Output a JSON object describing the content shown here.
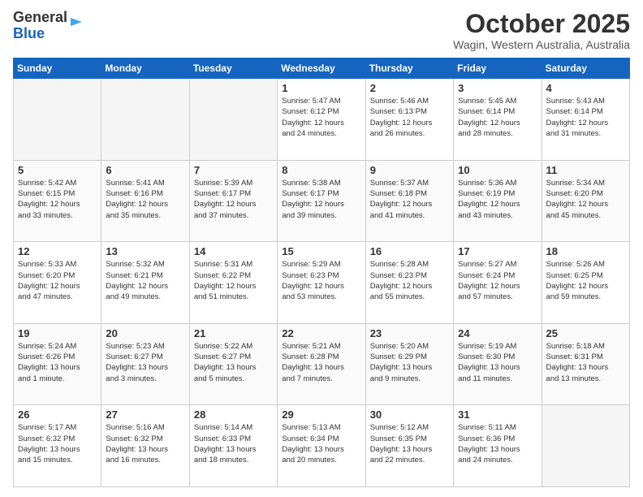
{
  "header": {
    "logo_general": "General",
    "logo_blue": "Blue",
    "month_title": "October 2025",
    "location": "Wagin, Western Australia, Australia"
  },
  "days_of_week": [
    "Sunday",
    "Monday",
    "Tuesday",
    "Wednesday",
    "Thursday",
    "Friday",
    "Saturday"
  ],
  "weeks": [
    [
      {
        "day": "",
        "info": ""
      },
      {
        "day": "",
        "info": ""
      },
      {
        "day": "",
        "info": ""
      },
      {
        "day": "1",
        "info": "Sunrise: 5:47 AM\nSunset: 6:12 PM\nDaylight: 12 hours\nand 24 minutes."
      },
      {
        "day": "2",
        "info": "Sunrise: 5:46 AM\nSunset: 6:13 PM\nDaylight: 12 hours\nand 26 minutes."
      },
      {
        "day": "3",
        "info": "Sunrise: 5:45 AM\nSunset: 6:14 PM\nDaylight: 12 hours\nand 28 minutes."
      },
      {
        "day": "4",
        "info": "Sunrise: 5:43 AM\nSunset: 6:14 PM\nDaylight: 12 hours\nand 31 minutes."
      }
    ],
    [
      {
        "day": "5",
        "info": "Sunrise: 5:42 AM\nSunset: 6:15 PM\nDaylight: 12 hours\nand 33 minutes."
      },
      {
        "day": "6",
        "info": "Sunrise: 5:41 AM\nSunset: 6:16 PM\nDaylight: 12 hours\nand 35 minutes."
      },
      {
        "day": "7",
        "info": "Sunrise: 5:39 AM\nSunset: 6:17 PM\nDaylight: 12 hours\nand 37 minutes."
      },
      {
        "day": "8",
        "info": "Sunrise: 5:38 AM\nSunset: 6:17 PM\nDaylight: 12 hours\nand 39 minutes."
      },
      {
        "day": "9",
        "info": "Sunrise: 5:37 AM\nSunset: 6:18 PM\nDaylight: 12 hours\nand 41 minutes."
      },
      {
        "day": "10",
        "info": "Sunrise: 5:36 AM\nSunset: 6:19 PM\nDaylight: 12 hours\nand 43 minutes."
      },
      {
        "day": "11",
        "info": "Sunrise: 5:34 AM\nSunset: 6:20 PM\nDaylight: 12 hours\nand 45 minutes."
      }
    ],
    [
      {
        "day": "12",
        "info": "Sunrise: 5:33 AM\nSunset: 6:20 PM\nDaylight: 12 hours\nand 47 minutes."
      },
      {
        "day": "13",
        "info": "Sunrise: 5:32 AM\nSunset: 6:21 PM\nDaylight: 12 hours\nand 49 minutes."
      },
      {
        "day": "14",
        "info": "Sunrise: 5:31 AM\nSunset: 6:22 PM\nDaylight: 12 hours\nand 51 minutes."
      },
      {
        "day": "15",
        "info": "Sunrise: 5:29 AM\nSunset: 6:23 PM\nDaylight: 12 hours\nand 53 minutes."
      },
      {
        "day": "16",
        "info": "Sunrise: 5:28 AM\nSunset: 6:23 PM\nDaylight: 12 hours\nand 55 minutes."
      },
      {
        "day": "17",
        "info": "Sunrise: 5:27 AM\nSunset: 6:24 PM\nDaylight: 12 hours\nand 57 minutes."
      },
      {
        "day": "18",
        "info": "Sunrise: 5:26 AM\nSunset: 6:25 PM\nDaylight: 12 hours\nand 59 minutes."
      }
    ],
    [
      {
        "day": "19",
        "info": "Sunrise: 5:24 AM\nSunset: 6:26 PM\nDaylight: 13 hours\nand 1 minute."
      },
      {
        "day": "20",
        "info": "Sunrise: 5:23 AM\nSunset: 6:27 PM\nDaylight: 13 hours\nand 3 minutes."
      },
      {
        "day": "21",
        "info": "Sunrise: 5:22 AM\nSunset: 6:27 PM\nDaylight: 13 hours\nand 5 minutes."
      },
      {
        "day": "22",
        "info": "Sunrise: 5:21 AM\nSunset: 6:28 PM\nDaylight: 13 hours\nand 7 minutes."
      },
      {
        "day": "23",
        "info": "Sunrise: 5:20 AM\nSunset: 6:29 PM\nDaylight: 13 hours\nand 9 minutes."
      },
      {
        "day": "24",
        "info": "Sunrise: 5:19 AM\nSunset: 6:30 PM\nDaylight: 13 hours\nand 11 minutes."
      },
      {
        "day": "25",
        "info": "Sunrise: 5:18 AM\nSunset: 6:31 PM\nDaylight: 13 hours\nand 13 minutes."
      }
    ],
    [
      {
        "day": "26",
        "info": "Sunrise: 5:17 AM\nSunset: 6:32 PM\nDaylight: 13 hours\nand 15 minutes."
      },
      {
        "day": "27",
        "info": "Sunrise: 5:16 AM\nSunset: 6:32 PM\nDaylight: 13 hours\nand 16 minutes."
      },
      {
        "day": "28",
        "info": "Sunrise: 5:14 AM\nSunset: 6:33 PM\nDaylight: 13 hours\nand 18 minutes."
      },
      {
        "day": "29",
        "info": "Sunrise: 5:13 AM\nSunset: 6:34 PM\nDaylight: 13 hours\nand 20 minutes."
      },
      {
        "day": "30",
        "info": "Sunrise: 5:12 AM\nSunset: 6:35 PM\nDaylight: 13 hours\nand 22 minutes."
      },
      {
        "day": "31",
        "info": "Sunrise: 5:11 AM\nSunset: 6:36 PM\nDaylight: 13 hours\nand 24 minutes."
      },
      {
        "day": "",
        "info": ""
      }
    ]
  ]
}
